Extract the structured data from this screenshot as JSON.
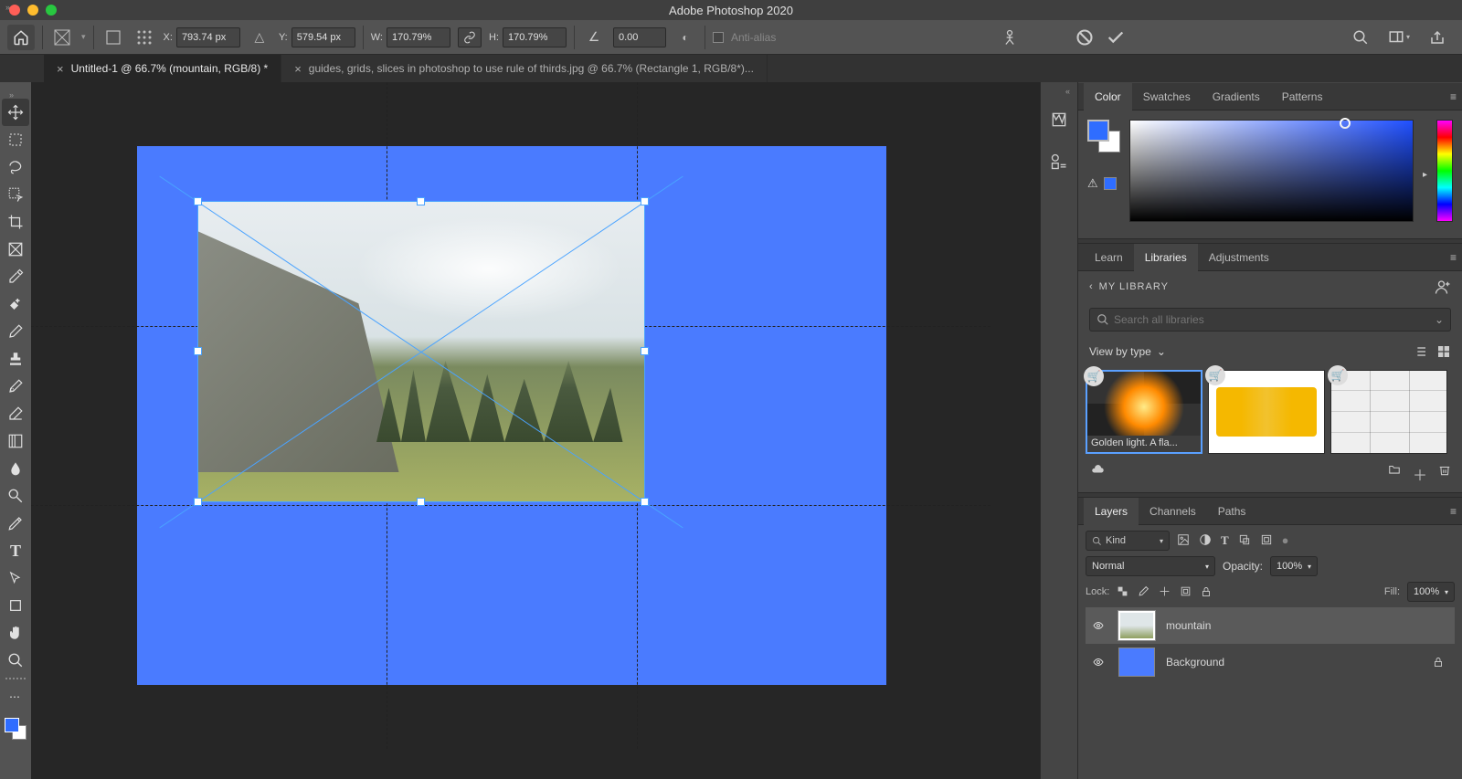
{
  "app_title": "Adobe Photoshop 2020",
  "options_bar": {
    "x_label": "X:",
    "x_value": "793.74 px",
    "y_label": "Y:",
    "y_value": "579.54 px",
    "w_label": "W:",
    "w_value": "170.79%",
    "h_label": "H:",
    "h_value": "170.79%",
    "angle_value": "0.00",
    "antialias_label": "Anti-alias"
  },
  "document_tabs": [
    {
      "title": "Untitled-1 @ 66.7% (mountain, RGB/8) *",
      "active": true
    },
    {
      "title": "guides, grids, slices in photoshop to use rule of thirds.jpg @ 66.7% (Rectangle 1, RGB/8*)...",
      "active": false
    }
  ],
  "color_panel": {
    "tabs": [
      "Color",
      "Swatches",
      "Gradients",
      "Patterns"
    ],
    "active": "Color"
  },
  "mid_panel": {
    "tabs": [
      "Learn",
      "Libraries",
      "Adjustments"
    ],
    "active": "Libraries",
    "library_name": "MY LIBRARY",
    "search_placeholder": "Search all libraries",
    "view_label": "View by type",
    "items": [
      {
        "label": "Golden light. A fla..."
      }
    ]
  },
  "layers_panel": {
    "tabs": [
      "Layers",
      "Channels",
      "Paths"
    ],
    "active": "Layers",
    "kind": "Kind",
    "blend_mode": "Normal",
    "opacity_label": "Opacity:",
    "opacity_value": "100%",
    "lock_label": "Lock:",
    "fill_label": "Fill:",
    "fill_value": "100%",
    "layers": [
      {
        "name": "mountain",
        "selected": true,
        "locked": false
      },
      {
        "name": "Background",
        "selected": false,
        "locked": true
      }
    ]
  }
}
